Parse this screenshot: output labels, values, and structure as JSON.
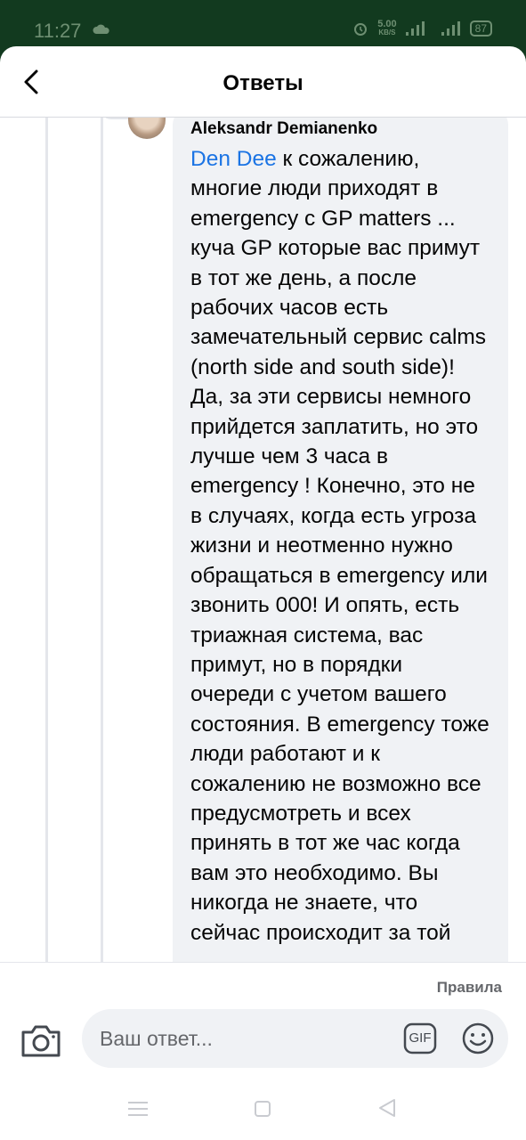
{
  "status_bar": {
    "time": "11:27",
    "net_speed_value": "5.00",
    "net_speed_unit": "KB/S",
    "battery": "87"
  },
  "header": {
    "title": "Ответы"
  },
  "comment": {
    "author": "Aleksandr Demianenko",
    "mention": "Den Dee",
    "text": " к сожалению, многие люди приходят в emergency с GP matters ... куча GP которые вас примут в тот же день, а после рабочих часов есть замечательный сервис calms (north side and south side)! Да, за эти сервисы немного прийдется заплатить, но это лучше чем 3 часа в emergency ! Конечно, это не в случаях, когда есть угроза жизни и неотменно нужно обращаться в emergency или звонить 000! И опять, есть триажная  система, вас примут, но в порядки очереди с учетом вашего состояния. В emergency тоже люди работают и к сожалению не возможно все предусмотреть и всех принять в тот же час когда вам это необходимо. Вы никогда не знаете, что сейчас происходит за той"
  },
  "footer": {
    "rules_label": "Правила",
    "reply_placeholder": "Ваш ответ...",
    "gif_label": "GIF"
  },
  "icons": {
    "back": "back-arrow-icon",
    "camera": "camera-icon",
    "gif": "gif-icon",
    "emoji": "emoji-icon",
    "nav_menu": "nav-menu-icon",
    "nav_home": "nav-home-icon",
    "nav_back": "nav-back-icon"
  },
  "colors": {
    "status_bar_bg": "#123a1f",
    "mention": "#1b74e4",
    "bubble_bg": "#f0f2f5"
  }
}
